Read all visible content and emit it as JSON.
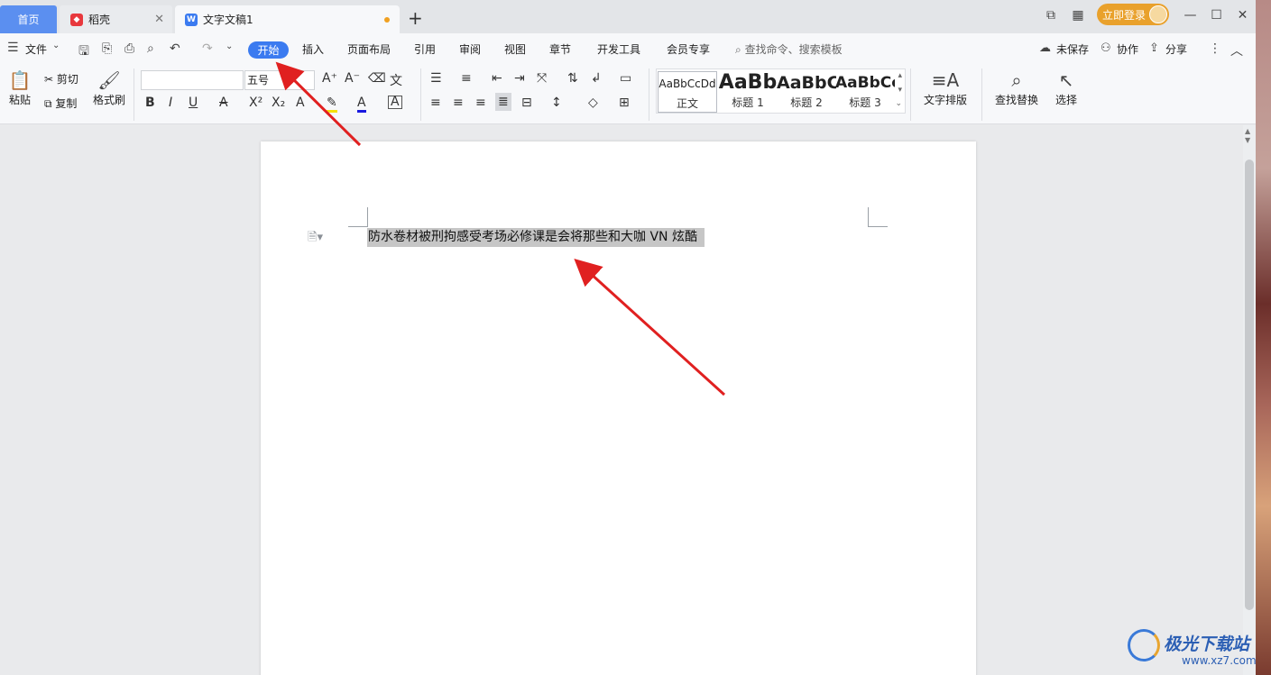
{
  "tabs": {
    "home": "首页",
    "daoke": "稻壳",
    "doc": "文字文稿1",
    "add": "+"
  },
  "window": {
    "login": "立即登录"
  },
  "menu": {
    "file": "文件",
    "start": "开始",
    "insert": "插入",
    "layout": "页面布局",
    "reference": "引用",
    "review": "审阅",
    "view": "视图",
    "chapter": "章节",
    "devtools": "开发工具",
    "member": "会员专享",
    "search": "查找命令、搜索模板",
    "unsaved": "未保存",
    "collab": "协作",
    "share": "分享"
  },
  "ribbon": {
    "paste": "粘贴",
    "cut": "剪切",
    "copy": "复制",
    "format_painter": "格式刷",
    "font_name": "",
    "font_size": "五号",
    "styles": [
      {
        "preview": "AaBbCcDd",
        "label": "正文"
      },
      {
        "preview": "AaBb",
        "label": "标题 1"
      },
      {
        "preview": "AaBbC",
        "label": "标题 2"
      },
      {
        "preview": "AaBbCc",
        "label": "标题 3"
      }
    ],
    "text_layout": "文字排版",
    "find_replace": "查找替换",
    "select": "选择"
  },
  "document": {
    "text": "防水卷材被刑拘感受考场必修课是会将那些和大咖 VN 炫酷"
  },
  "watermark": {
    "name": "极光下载站",
    "url": "www.xz7.com"
  },
  "colors": {
    "accent": "#3b7bf0",
    "home_tab": "#5b8ff0",
    "login": "#e9a12c",
    "arrow": "#e02020",
    "selection": "#c6c6c6"
  }
}
